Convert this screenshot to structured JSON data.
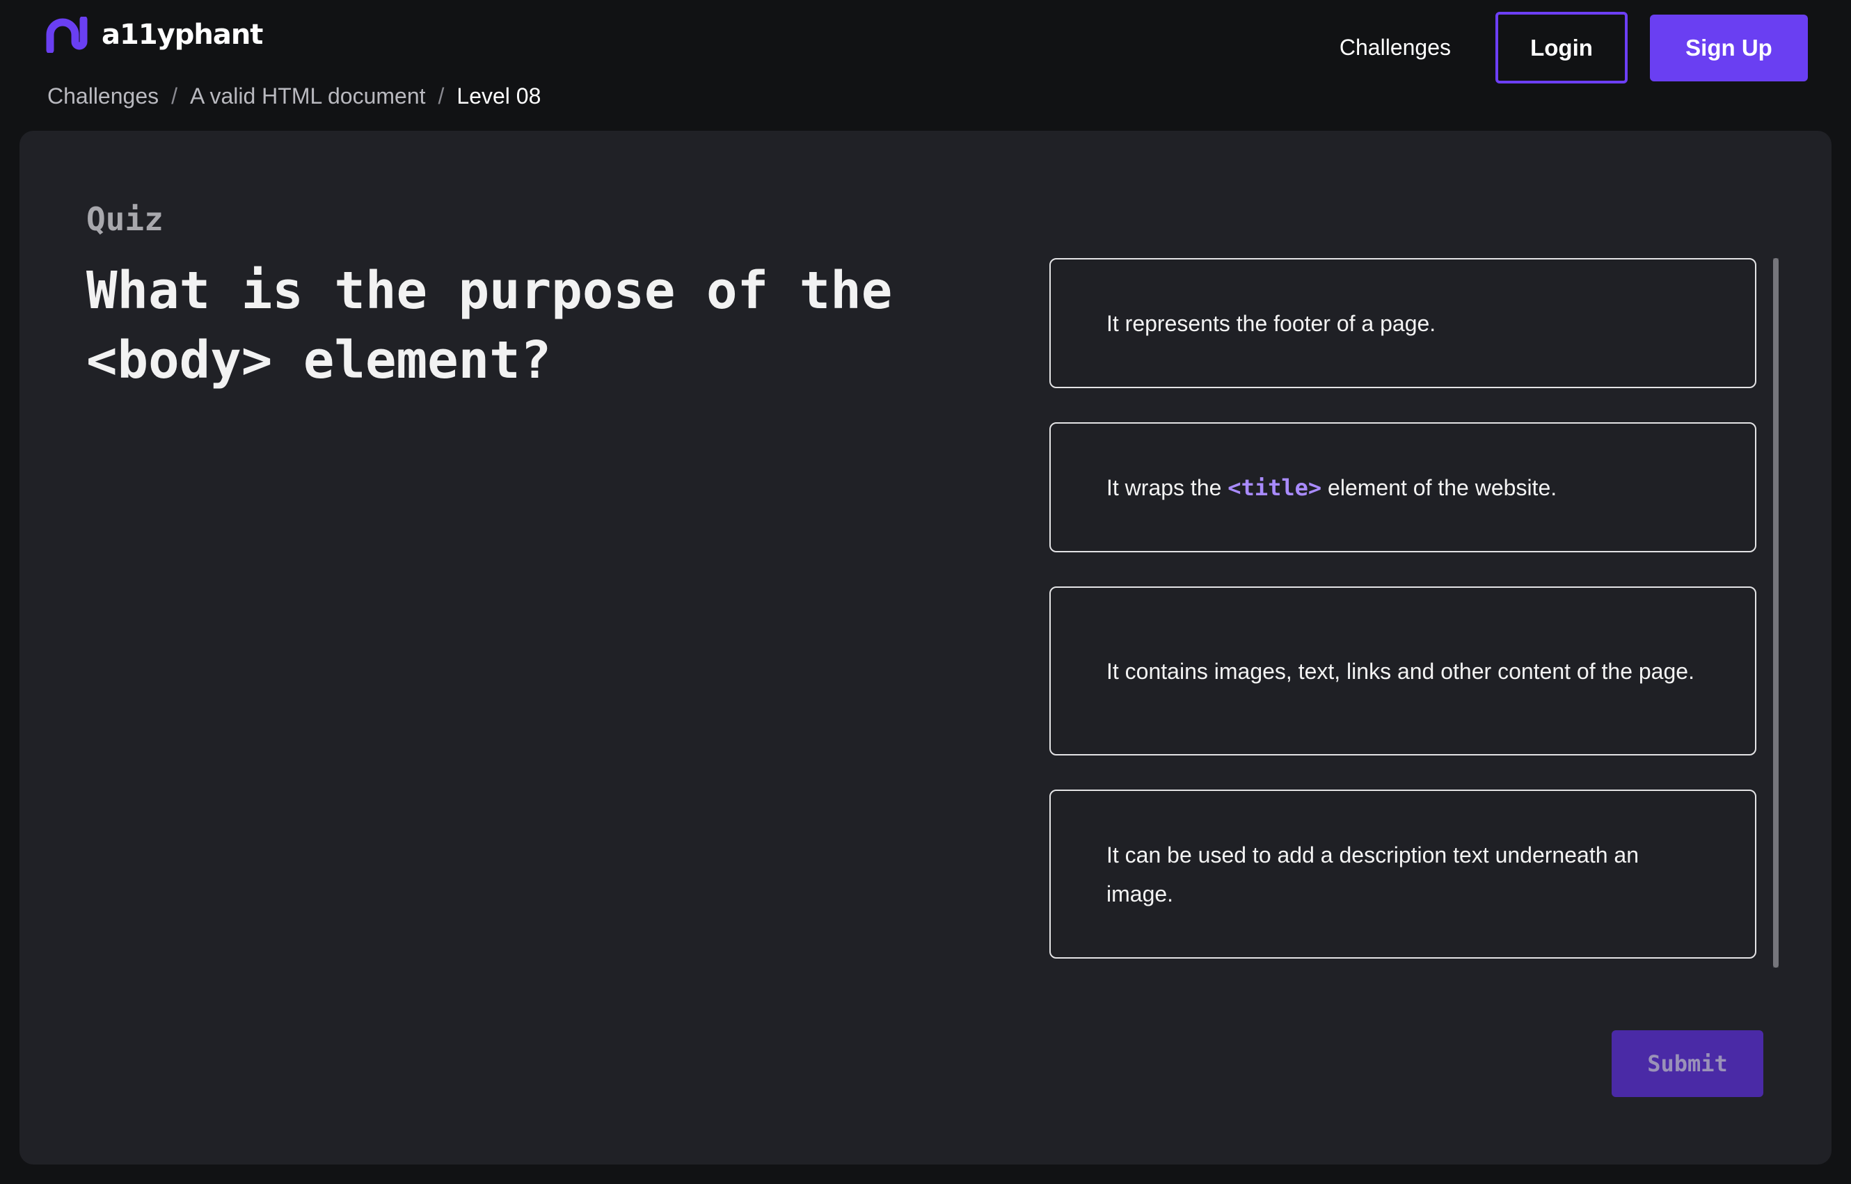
{
  "brand": {
    "name": "a11yphant",
    "accent_color": "#6a3ff2",
    "logo_icon": "a11yphant-logo-icon"
  },
  "nav": {
    "challenges_label": "Challenges",
    "login_label": "Login",
    "signup_label": "Sign Up"
  },
  "breadcrumb": {
    "items": [
      "Challenges",
      "A valid HTML document",
      "Level 08"
    ],
    "separator": "/"
  },
  "quiz": {
    "label": "Quiz",
    "question": "What is the purpose of the <body> element?",
    "options": [
      {
        "text": "It represents the footer of a page."
      },
      {
        "pre": "It wraps the ",
        "code": "<title>",
        "post": " element of the website."
      },
      {
        "text": "It contains images, text, links and other content of the page."
      },
      {
        "text": "It can be used to add a description text underneath an image."
      }
    ],
    "submit_label": "Submit"
  }
}
